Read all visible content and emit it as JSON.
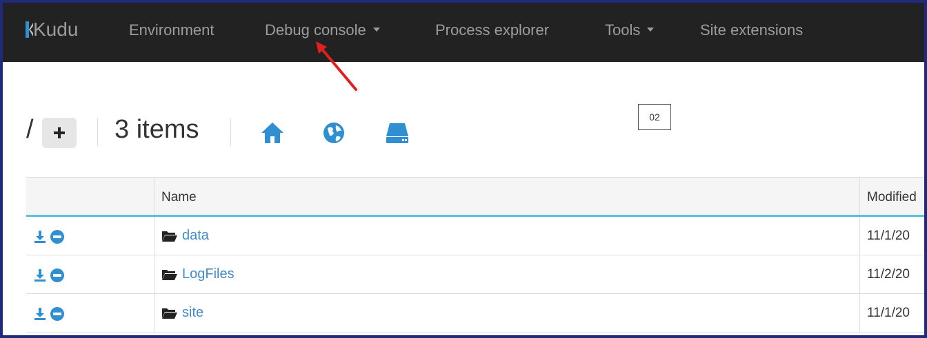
{
  "navbar": {
    "brand": "Kudu",
    "items": [
      {
        "label": "Environment",
        "dropdown": false
      },
      {
        "label": "Debug console",
        "dropdown": true
      },
      {
        "label": "Process explorer",
        "dropdown": false
      },
      {
        "label": "Tools",
        "dropdown": true
      },
      {
        "label": "Site extensions",
        "dropdown": false
      }
    ]
  },
  "toolbar": {
    "path": "/",
    "add_icon": "plus-icon",
    "item_count": "3 items",
    "icons": [
      "home-icon",
      "globe-icon",
      "drive-icon"
    ]
  },
  "annotation": {
    "label": "02"
  },
  "table": {
    "headers": {
      "actions": "",
      "name": "Name",
      "modified": "Modified"
    },
    "rows": [
      {
        "name": "data",
        "modified": "11/1/20"
      },
      {
        "name": "LogFiles",
        "modified": "11/2/20"
      },
      {
        "name": "site",
        "modified": "11/1/20"
      }
    ]
  },
  "colors": {
    "navbar_bg": "#222222",
    "nav_text": "#9d9d9d",
    "link": "#428bca",
    "accent_border": "#5bc0de",
    "annotation_arrow": "#e02020",
    "frame": "#1e2a7a"
  }
}
